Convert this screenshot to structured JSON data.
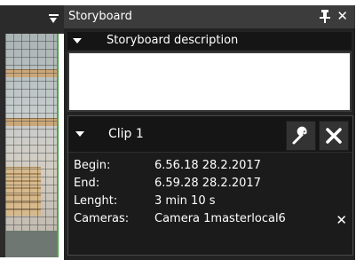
{
  "panel": {
    "title": "Storyboard",
    "description_header": "Storyboard description",
    "description_value": ""
  },
  "clip": {
    "title": "Clip 1",
    "fields": [
      {
        "key": "Begin:",
        "value": "6.56.18 28.2.2017"
      },
      {
        "key": "End:",
        "value": "6.59.28 28.2.2017"
      },
      {
        "key": "Lenght:",
        "value": "3 min 10 s"
      },
      {
        "key": "Cameras:",
        "value": "Camera 1masterlocal6"
      }
    ]
  },
  "icons": {
    "pin": "pin-icon",
    "close": "close-icon",
    "wrench": "wrench-icon",
    "menu": "menu-down-icon"
  },
  "colors": {
    "panel_bg": "#232323",
    "titlebar_bg": "#3c3c3c",
    "video_border": "#4da34a"
  }
}
